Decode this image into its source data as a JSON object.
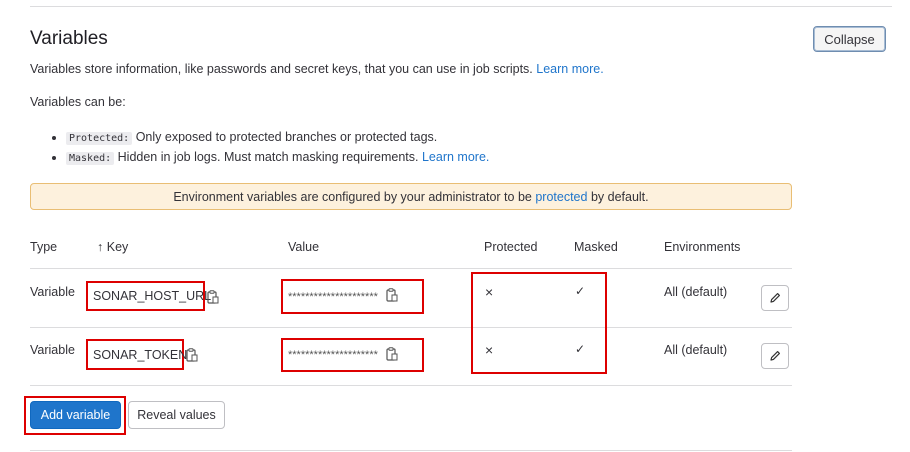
{
  "section": {
    "title": "Variables",
    "collapse_label": "Collapse",
    "description": "Variables store information, like passwords and secret keys, that you can use in job scripts.",
    "learn_more": "Learn more.",
    "can_be": "Variables can be:",
    "bullets": [
      {
        "tag": "Protected:",
        "text": "Only exposed to protected branches or protected tags.",
        "link": ""
      },
      {
        "tag": "Masked:",
        "text": "Hidden in job logs. Must match masking requirements.",
        "link": "Learn more."
      }
    ]
  },
  "alert": {
    "before": "Environment variables are configured by your administrator to be",
    "link": "protected",
    "after": "by default."
  },
  "table": {
    "headers": {
      "type": "Type",
      "key_arrow": "↑",
      "key": "Key",
      "value": "Value",
      "protected": "Protected",
      "masked": "Masked",
      "environments": "Environments"
    },
    "rows": [
      {
        "type": "Variable",
        "key": "SONAR_HOST_URL",
        "value": "*********************",
        "protected": "×",
        "masked": "✓",
        "environments": "All (default)"
      },
      {
        "type": "Variable",
        "key": "SONAR_TOKEN",
        "value": "*********************",
        "protected": "×",
        "masked": "✓",
        "environments": "All (default)"
      }
    ]
  },
  "actions": {
    "add_variable": "Add variable",
    "reveal_values": "Reveal values"
  },
  "colors": {
    "link": "#1f75cb",
    "primary_button": "#1f75cb",
    "alert_bg": "#fdf1dd",
    "alert_border": "#e9be74",
    "highlight": "#dd0000"
  },
  "icons": {
    "copy": "clipboard-icon",
    "edit": "pencil-icon"
  }
}
